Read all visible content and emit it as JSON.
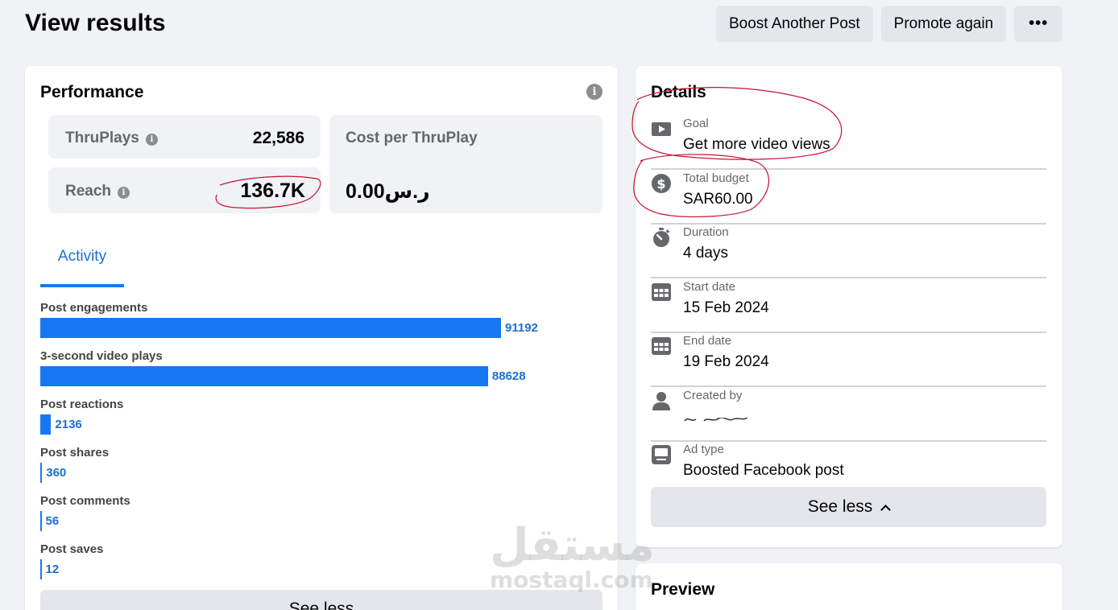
{
  "header": {
    "title": "View results",
    "buttons": [
      "Boost Another Post",
      "Promote again",
      "•••"
    ]
  },
  "performance": {
    "title": "Performance",
    "metrics": {
      "thruplays": {
        "label": "ThruPlays",
        "value": "22,586"
      },
      "reach": {
        "label": "Reach",
        "value": "136.7K"
      },
      "cost": {
        "label": "Cost per ThruPlay",
        "value": "0.00ر.س"
      }
    },
    "tab": "Activity",
    "activity": [
      {
        "label": "Post engagements",
        "value": 91192
      },
      {
        "label": "3-second video plays",
        "value": 88628
      },
      {
        "label": "Post reactions",
        "value": 2136
      },
      {
        "label": "Post shares",
        "value": 360
      },
      {
        "label": "Post comments",
        "value": 56
      },
      {
        "label": "Post saves",
        "value": 12
      }
    ],
    "see_less": "See less"
  },
  "details": {
    "title": "Details",
    "items": [
      {
        "icon": "video-play-icon",
        "label": "Goal",
        "value": "Get more video views"
      },
      {
        "icon": "dollar-icon",
        "label": "Total budget",
        "value": "SAR60.00"
      },
      {
        "icon": "stopwatch-icon",
        "label": "Duration",
        "value": "4 days"
      },
      {
        "icon": "calendar-icon",
        "label": "Start date",
        "value": "15 Feb 2024"
      },
      {
        "icon": "calendar-icon",
        "label": "End date",
        "value": "19 Feb 2024"
      },
      {
        "icon": "person-icon",
        "label": "Created by",
        "value": ""
      },
      {
        "icon": "ad-type-icon",
        "label": "Ad type",
        "value": "Boosted Facebook post"
      }
    ],
    "see_less": "See less"
  },
  "preview": {
    "title": "Preview"
  },
  "watermark": {
    "arabic": "مستقل",
    "latin": "mostaql.com"
  },
  "colors": {
    "accent": "#1877f2",
    "annotation": "#c8102e",
    "background": "#f0f2f5"
  }
}
